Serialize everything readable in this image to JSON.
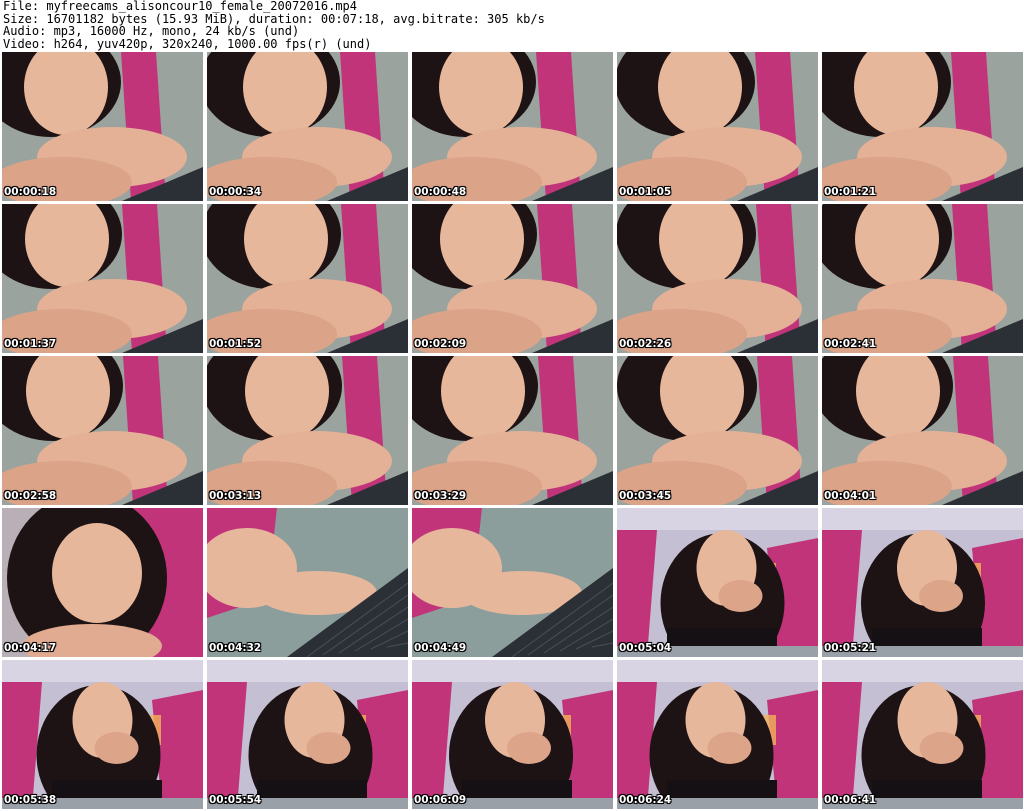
{
  "header": {
    "file_line": "File: myfreecams_alisoncour10_female_20072016.mp4",
    "size_line": "Size: 16701182 bytes (15.93 MiB), duration: 00:07:18, avg.bitrate: 305 kb/s",
    "audio_line": "Audio: mp3, 16000 Hz, mono, 24 kb/s (und)",
    "video_line": "Video: h264, yuv420p, 320x240, 1000.00 fps(r) (und)"
  },
  "colors": {
    "wall_gray": "#9aa39e",
    "wall_pink": "#c2347a",
    "skin": "#e7b79c",
    "hair": "#1d1214",
    "keyboard": "#2b2f36",
    "text": "#000000",
    "timestamp": "#ffffff"
  },
  "thumbnails": [
    {
      "time": "00:00:18",
      "view": "closeup-hands"
    },
    {
      "time": "00:00:34",
      "view": "closeup-hands"
    },
    {
      "time": "00:00:48",
      "view": "closeup-hands"
    },
    {
      "time": "00:01:05",
      "view": "closeup-hands"
    },
    {
      "time": "00:01:21",
      "view": "closeup-hands"
    },
    {
      "time": "00:01:37",
      "view": "closeup-hands"
    },
    {
      "time": "00:01:52",
      "view": "closeup-hands"
    },
    {
      "time": "00:02:09",
      "view": "closeup-hands"
    },
    {
      "time": "00:02:26",
      "view": "closeup-hands"
    },
    {
      "time": "00:02:41",
      "view": "closeup-hands"
    },
    {
      "time": "00:02:58",
      "view": "closeup-hands"
    },
    {
      "time": "00:03:13",
      "view": "closeup-hands"
    },
    {
      "time": "00:03:29",
      "view": "closeup-hands"
    },
    {
      "time": "00:03:45",
      "view": "closeup-hands"
    },
    {
      "time": "00:04:01",
      "view": "closeup-hands"
    },
    {
      "time": "00:04:17",
      "view": "portrait"
    },
    {
      "time": "00:04:32",
      "view": "keyboard"
    },
    {
      "time": "00:04:49",
      "view": "keyboard"
    },
    {
      "time": "00:05:04",
      "view": "wide"
    },
    {
      "time": "00:05:21",
      "view": "wide"
    },
    {
      "time": "00:05:38",
      "view": "wide"
    },
    {
      "time": "00:05:54",
      "view": "wide"
    },
    {
      "time": "00:06:09",
      "view": "wide"
    },
    {
      "time": "00:06:24",
      "view": "wide"
    },
    {
      "time": "00:06:41",
      "view": "wide"
    }
  ]
}
